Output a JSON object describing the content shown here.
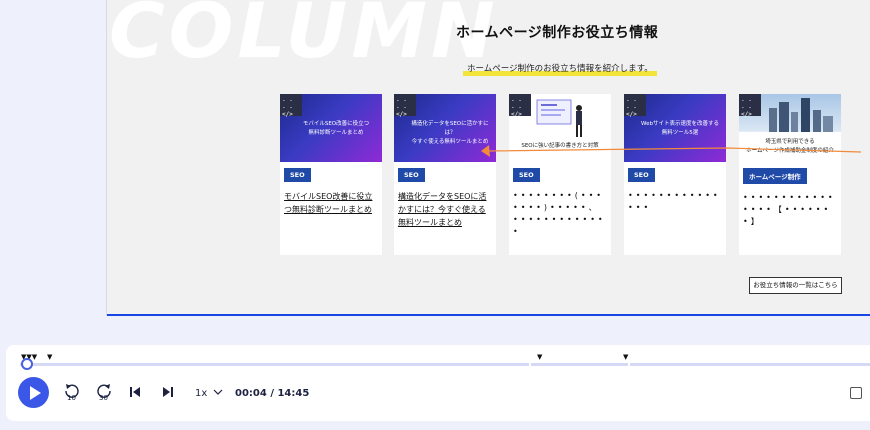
{
  "page": {
    "watermark": "COLUMN",
    "title": "ホームページ制作お役立ち情報",
    "subtitle": "ホームページ制作のお役立ち情報を紹介します。",
    "more_button": "お役立ち情報の一覧はこちら",
    "cards": [
      {
        "thumb_code": "- - - -\n</>",
        "thumb_title": "モバイルSEO改善に役立つ\n無料診断ツールまとめ",
        "tag": "SEO",
        "text": "モバイルSEO改善に役立つ無料診断ツールまとめ"
      },
      {
        "thumb_code": "- - - -\n</>",
        "thumb_title": "構造化データをSEOに活かすには？\n今すぐ使える無料ツールまとめ",
        "tag": "SEO",
        "text": "構造化データをSEOに活かすには？今すぐ使える無料ツールまとめ"
      },
      {
        "thumb_code": "- - - -\n</>",
        "thumb_title": "SEOに強い記事の書き方と対策",
        "tag": "SEO",
        "text": "••••••••(•••••••)•••••、•••••••••••••"
      },
      {
        "thumb_code": "- - - -\n</>",
        "thumb_title": "Webサイト表示速度を改善する\n無料ツール5選",
        "tag": "SEO",
        "text": "•••••••••••••••"
      },
      {
        "thumb_code": "- - - -\n</>",
        "thumb_title": "埼玉県で利用できる\nホームページ作成補助金制度の紹介",
        "tag": "ホームページ制作",
        "text": "••••••••••••••••【•••••••】"
      }
    ]
  },
  "player": {
    "rewind_label": "10",
    "forward_label": "30",
    "speed": "1x",
    "time": "00:04 / 14:45",
    "progress": 0.005,
    "icons": [
      "play-icon",
      "rewind-10-icon",
      "forward-30-icon",
      "previous-icon",
      "next-icon",
      "chevron-down-icon"
    ]
  },
  "colors": {
    "accent": "#3a57e8",
    "band": "#1a45e6",
    "tag": "#1f4aa8",
    "highlight": "#f3e43a"
  }
}
